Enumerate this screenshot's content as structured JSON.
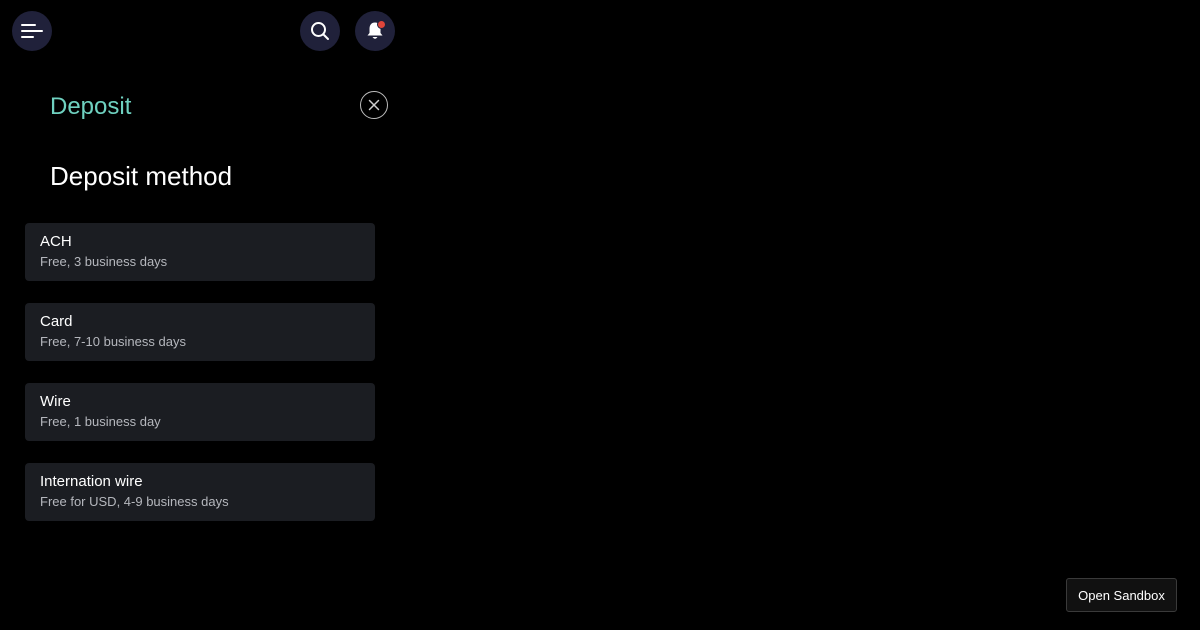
{
  "header": {
    "menu_icon": "menu-icon",
    "search_icon": "search-icon",
    "bell_icon": "bell-icon",
    "notification_color": "#e0453a"
  },
  "panel": {
    "title": "Deposit",
    "title_color": "#6fd1c0",
    "close_icon": "close-icon",
    "section_heading": "Deposit method",
    "methods": [
      {
        "name": "ACH",
        "description": "Free, 3 business days"
      },
      {
        "name": "Card",
        "description": "Free, 7-10 business days"
      },
      {
        "name": "Wire",
        "description": "Free, 1 business day"
      },
      {
        "name": "Internation wire",
        "description": "Free for USD, 4-9 business days"
      }
    ]
  },
  "footer": {
    "sandbox_label": "Open Sandbox"
  }
}
